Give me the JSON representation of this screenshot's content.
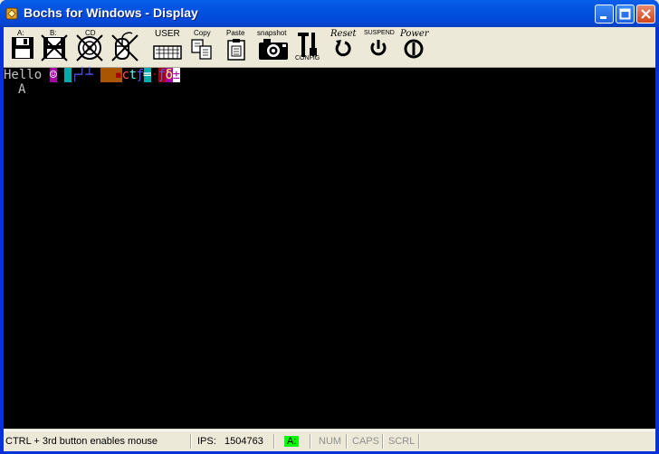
{
  "window": {
    "title": "Bochs for Windows - Display"
  },
  "toolbar": {
    "floppy_a": "A:",
    "floppy_b": "B:",
    "cdrom": "CD",
    "user": "USER",
    "copy": "Copy",
    "paste": "Paste",
    "snapshot": "snapshot",
    "config": "CONFIG",
    "reset": "Reset",
    "suspend": "SUSPEND",
    "power": "Power"
  },
  "screen": {
    "line1_text": "Hello",
    "line2_text": "A",
    "glyphs": [
      {
        "ch": "☺",
        "fg": "#ffffff",
        "bg": "#aa00aa"
      },
      {
        "ch": " ",
        "fg": "#000000",
        "bg": "#000000"
      },
      {
        "ch": " ",
        "fg": "#000000",
        "bg": "#00aaaa"
      },
      {
        "ch": "┌",
        "fg": "#5555ff",
        "bg": "#000000"
      },
      {
        "ch": "┘",
        "fg": "#5555ff",
        "bg": "#000000"
      },
      {
        "ch": "┴",
        "fg": "#5555ff",
        "bg": "#000000"
      },
      {
        "ch": " ",
        "fg": "#000000",
        "bg": "#000000"
      },
      {
        "ch": " ",
        "fg": "#000000",
        "bg": "#aa5500"
      },
      {
        "ch": " ",
        "fg": "#000000",
        "bg": "#aa5500"
      },
      {
        "ch": "▪",
        "fg": "#aa0000",
        "bg": "#aa5500"
      },
      {
        "ch": "c",
        "fg": "#ff5555",
        "bg": "#000000"
      },
      {
        "ch": "t",
        "fg": "#55ffff",
        "bg": "#000000"
      },
      {
        "ch": "ƒ",
        "fg": "#5555ff",
        "bg": "#000000"
      },
      {
        "ch": "═",
        "fg": "#ffffff",
        "bg": "#00aaaa"
      },
      {
        "ch": "·",
        "fg": "#aa0000",
        "bg": "#000000"
      },
      {
        "ch": "ƒ",
        "fg": "#5555ff",
        "bg": "#aa0000"
      },
      {
        "ch": "δ",
        "fg": "#ffff55",
        "bg": "#aa00aa"
      },
      {
        "ch": "±",
        "fg": "#aa00aa",
        "bg": "#ffffff"
      }
    ]
  },
  "status": {
    "hint": "CTRL + 3rd button enables mouse",
    "ips_label": "IPS:",
    "ips_value": "1504763",
    "drive_a": "A:",
    "num": "NUM",
    "caps": "CAPS",
    "scrl": "SCRL"
  }
}
